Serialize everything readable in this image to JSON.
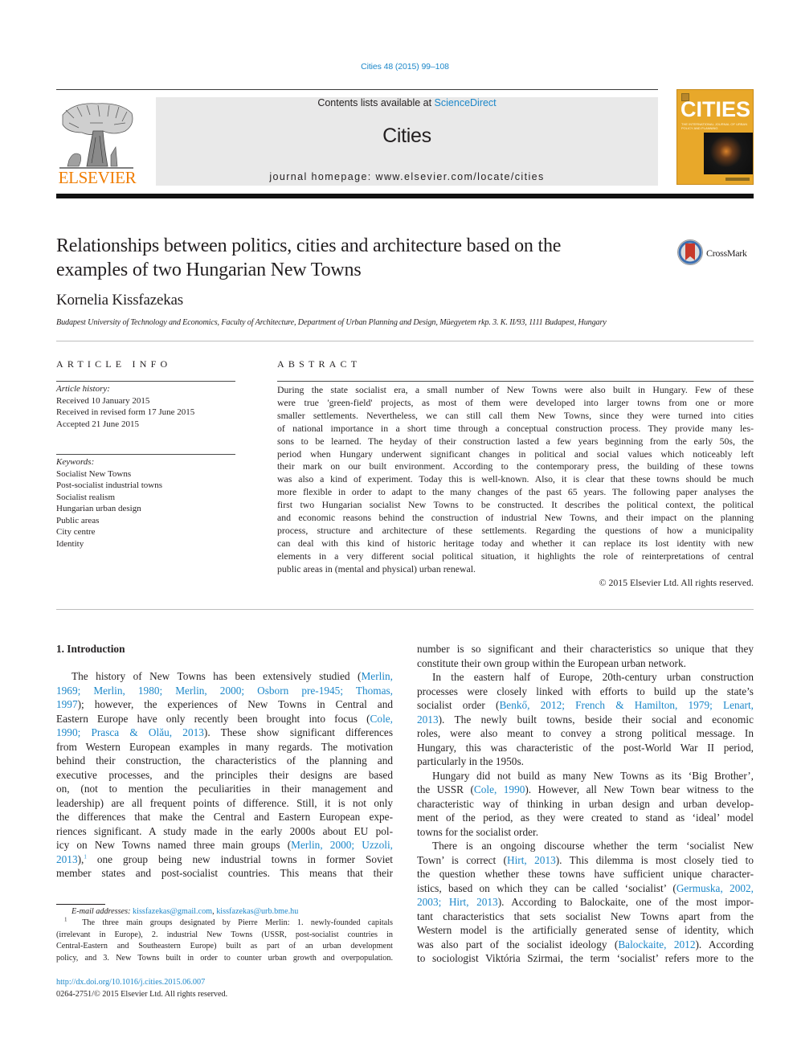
{
  "header": {
    "journal_reference": "Cities 48 (2015) 99–108",
    "contents_prefix": "Contents lists available at ",
    "contents_link": "ScienceDirect",
    "journal_name": "Cities",
    "homepage": "journal homepage: www.elsevier.com/locate/cities",
    "publisher_wordmark": "ELSEVIER",
    "cover": {
      "title": "CITIES",
      "subtitle": "THE INTERNATIONAL JOURNAL OF URBAN POLICY AND PLANNING",
      "color": "#e8a82a"
    }
  },
  "article": {
    "title_lines": [
      "Relationships between politics, cities and architecture based on the",
      "examples of two Hungarian New Towns"
    ],
    "crossmark_label": "CrossMark",
    "author": "Kornelia Kissfazekas",
    "affiliation": "Budapest University of Technology and Economics, Faculty of Architecture, Department of Urban Planning and Design, Müegyetem rkp. 3. K. II/93, 1111 Budapest, Hungary"
  },
  "article_info": {
    "heading": "ARTICLE INFO",
    "history_label": "Article history:",
    "history": [
      "Received 10 January 2015",
      "Received in revised form 17 June 2015",
      "Accepted 21 June 2015"
    ],
    "keywords_label": "Keywords:",
    "keywords": [
      "Socialist New Towns",
      "Post-socialist industrial towns",
      "Socialist realism",
      "Hungarian urban design",
      "Public areas",
      "City centre",
      "Identity"
    ]
  },
  "abstract": {
    "heading": "ABSTRACT",
    "lines": [
      "During the state socialist era, a small number of New Towns were also built in Hungary. Few of these",
      "were true 'green-field' projects, as most of them were developed into larger towns from one or more",
      "smaller settlements. Nevertheless, we can still call them New Towns, since they were turned into cities",
      "of national importance in a short time through a conceptual construction process. They provide many les-",
      "sons to be learned. The heyday of their construction lasted a few years beginning from the early 50s, the",
      "period when Hungary underwent significant changes in political and social values which noticeably left",
      "their mark on our built environment. According to the contemporary press, the building of these towns",
      "was also a kind of experiment. Today this is well-known. Also, it is clear that these towns should be much",
      "more flexible in order to adapt to the many changes of the past 65 years. The following paper analyses the",
      "first two Hungarian socialist New Towns to be constructed. It describes the political context, the political",
      "and economic reasons behind the construction of industrial New Towns, and their impact on the planning",
      "process, structure and architecture of these settlements. Regarding the questions of how a municipality",
      "can deal with this kind of historic heritage today and whether it can replace its lost identity with new",
      "elements in a very different social political situation, it highlights the role of reinterpretations of central"
    ],
    "last_line": "public areas in (mental and physical) urban renewal.",
    "copyright": "© 2015 Elsevier Ltd. All rights reserved."
  },
  "body": {
    "section_heading": "1. Introduction",
    "left_column": {
      "lines": [
        [
          {
            "t": "The history of New Towns has been extensively studied ("
          },
          {
            "t": "Merlin,",
            "link": true
          }
        ],
        [
          {
            "t": "1969; Merlin, 1980; Merlin, 2000; Osborn pre-1945; Thomas,",
            "link": true
          }
        ],
        [
          {
            "t": "1997",
            "link": true
          },
          {
            "t": "); however, the experiences of New Towns in Central and"
          }
        ],
        [
          {
            "t": "Eastern Europe have only recently been brought into focus ("
          },
          {
            "t": "Cole,",
            "link": true
          }
        ],
        [
          {
            "t": "1990; Prasca & Olău, 2013",
            "link": true
          },
          {
            "t": "). These show significant differences"
          }
        ],
        [
          {
            "t": "from Western European examples in many regards. The motivation"
          }
        ],
        [
          {
            "t": "behind their construction, the characteristics of the planning and"
          }
        ],
        [
          {
            "t": "executive processes, and the principles their designs are based"
          }
        ],
        [
          {
            "t": "on, (not to mention the peculiarities in their management and"
          }
        ],
        [
          {
            "t": "leadership) are all frequent points of difference. Still, it is not only"
          }
        ],
        [
          {
            "t": "the differences that make the Central and Eastern European expe-"
          }
        ],
        [
          {
            "t": "riences significant. A study made in the early 2000s about EU pol-"
          }
        ],
        [
          {
            "t": "icy on New Towns named three main groups ("
          },
          {
            "t": "Merlin, 2000; Uzzoli,",
            "link": true
          }
        ],
        [
          {
            "t": "2013",
            "link": true
          },
          {
            "t": "),"
          },
          {
            "t": "1",
            "sup": true
          },
          {
            "t": " one group being new industrial towns in former Soviet"
          }
        ],
        [
          {
            "t": "member states and post-socialist countries. This means that their"
          }
        ]
      ]
    },
    "right_column": {
      "lines": [
        [
          {
            "t": "number is so significant and their characteristics so unique that they"
          }
        ],
        [
          {
            "t": "constitute their own group within the European urban network."
          }
        ],
        [
          {
            "t": "In the eastern half of Europe, 20th-century urban construction"
          }
        ],
        [
          {
            "t": "processes were closely linked with efforts to build up the state’s"
          }
        ],
        [
          {
            "t": "socialist order ("
          },
          {
            "t": "Benkő, 2012; French & Hamilton, 1979; Lenart,",
            "link": true
          }
        ],
        [
          {
            "t": "2013",
            "link": true
          },
          {
            "t": "). The newly built towns, beside their social and economic"
          }
        ],
        [
          {
            "t": "roles, were also meant to convey a strong political message. In"
          }
        ],
        [
          {
            "t": "Hungary, this was characteristic of the post-World War II period,"
          }
        ],
        [
          {
            "t": "particularly in the 1950s."
          }
        ],
        [
          {
            "t": "Hungary did not build as many New Towns as its ‘Big Brother’,"
          }
        ],
        [
          {
            "t": "the USSR ("
          },
          {
            "t": "Cole, 1990",
            "link": true
          },
          {
            "t": "). However, all New Town bear witness to the"
          }
        ],
        [
          {
            "t": "characteristic way of thinking in urban design and urban develop-"
          }
        ],
        [
          {
            "t": "ment of the period, as they were created to stand as ‘ideal’ model"
          }
        ],
        [
          {
            "t": "towns for the socialist order."
          }
        ],
        [
          {
            "t": "There is an ongoing discourse whether the term ‘socialist New"
          }
        ],
        [
          {
            "t": "Town’ is correct ("
          },
          {
            "t": "Hirt, 2013",
            "link": true
          },
          {
            "t": "). This dilemma is most closely tied to"
          }
        ],
        [
          {
            "t": "the question whether these towns have sufficient unique character-"
          }
        ],
        [
          {
            "t": "istics, based on which they can be called ‘socialist’ ("
          },
          {
            "t": "Germuska, 2002,",
            "link": true
          }
        ],
        [
          {
            "t": "2003; Hirt, 2013",
            "link": true
          },
          {
            "t": "). According to Balockaite, one of the most impor-"
          }
        ],
        [
          {
            "t": "tant characteristics that sets socialist New Towns apart from the"
          }
        ],
        [
          {
            "t": "Western model is the artificially generated sense of identity, which"
          }
        ],
        [
          {
            "t": "was also part of the socialist ideology ("
          },
          {
            "t": "Balockaite, 2012",
            "link": true
          },
          {
            "t": "). According"
          }
        ],
        [
          {
            "t": "to sociologist Viktória Szirmai, the term ‘socialist’ refers more to the"
          }
        ]
      ]
    }
  },
  "footnotes": {
    "email_label": "E-mail addresses:",
    "emails": [
      "kissfazekas@gmail.com",
      "kissfazekas@urb.bme.hu"
    ],
    "email_separator": ", ",
    "note_number": "1",
    "note_lines": [
      "The three main groups designated by Pierre Merlin: 1. newly-founded capitals",
      "(irrelevant in Europe), 2. industrial New Towns (USSR, post-socialist countries in",
      "Central-Eastern and Southeastern Europe) built as part of an urban development"
    ],
    "note_last_line": "policy, and 3. New Towns built in order to counter urban growth and overpopulation."
  },
  "doi": {
    "link": "http://dx.doi.org/10.1016/j.cities.2015.06.007",
    "issn_line": "0264-2751/© 2015 Elsevier Ltd. All rights reserved."
  },
  "colors": {
    "link": "#1c87c9",
    "elsevier_orange": "#f07d00",
    "header_box": "#e9e9e9",
    "text": "#231f20"
  }
}
